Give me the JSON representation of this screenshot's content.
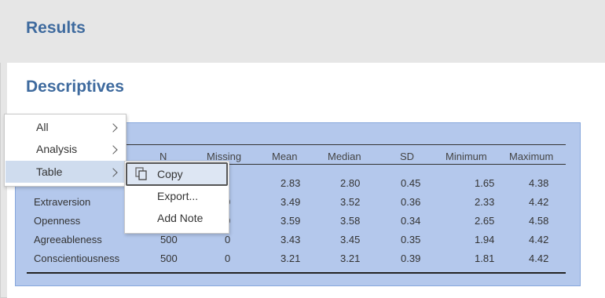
{
  "header": {
    "title": "Results"
  },
  "section": {
    "title": "Descriptives"
  },
  "table": {
    "columns": [
      "N",
      "Missing",
      "Mean",
      "Median",
      "SD",
      "Minimum",
      "Maximum"
    ],
    "rows": [
      {
        "label": "",
        "n": "",
        "missing": "",
        "mean": "2.83",
        "median": "2.80",
        "sd": "0.45",
        "min": "1.65",
        "max": "4.38"
      },
      {
        "label": "Extraversion",
        "n": "",
        "missing": "0",
        "mean": "3.49",
        "median": "3.52",
        "sd": "0.36",
        "min": "2.33",
        "max": "4.42"
      },
      {
        "label": "Openness",
        "n": "",
        "missing": "0",
        "mean": "3.59",
        "median": "3.58",
        "sd": "0.34",
        "min": "2.65",
        "max": "4.58"
      },
      {
        "label": "Agreeableness",
        "n": "500",
        "missing": "0",
        "mean": "3.43",
        "median": "3.45",
        "sd": "0.35",
        "min": "1.94",
        "max": "4.42"
      },
      {
        "label": "Conscientiousness",
        "n": "500",
        "missing": "0",
        "mean": "3.21",
        "median": "3.21",
        "sd": "0.39",
        "min": "1.81",
        "max": "4.42"
      }
    ]
  },
  "context_menu": {
    "items": [
      "All",
      "Analysis",
      "Table"
    ],
    "selected": "Table"
  },
  "submenu": {
    "items": [
      "Copy",
      "Export...",
      "Add Note"
    ],
    "highlighted": "Copy"
  },
  "colors": {
    "accent": "#3e6a9e",
    "table_bg": "#b4c8ec",
    "menu_highlight": "#cfdcee"
  }
}
